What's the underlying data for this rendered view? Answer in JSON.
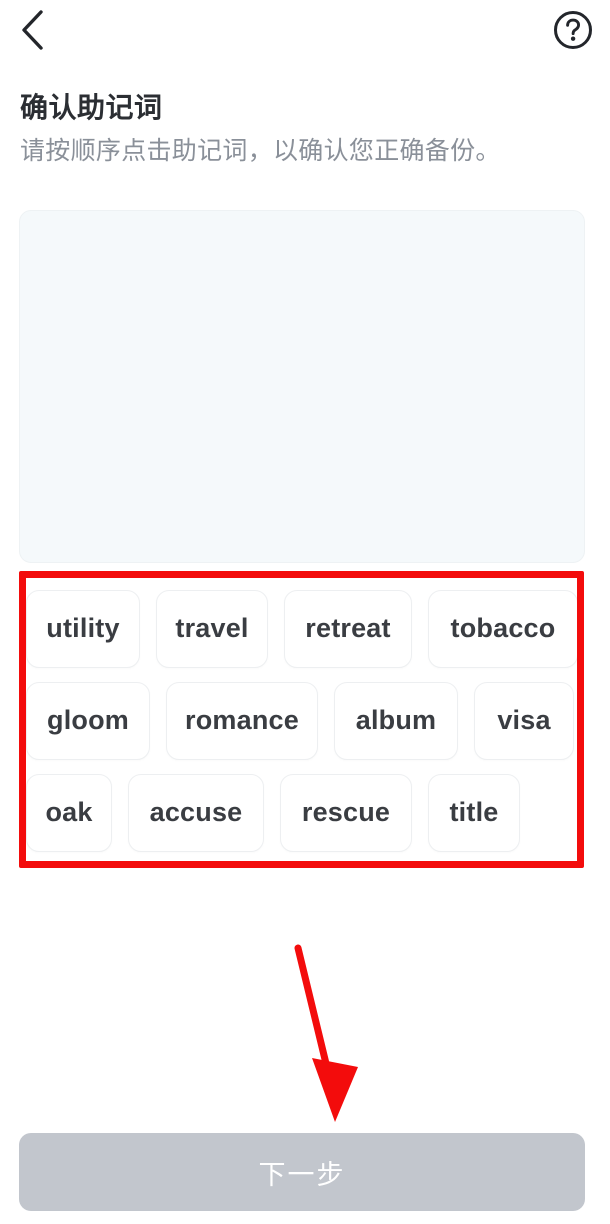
{
  "navbar": {
    "back_icon": "chevron-left-icon",
    "help_icon": "question-circle-icon"
  },
  "header": {
    "title": "确认助记词",
    "subtitle": "请按顺序点击助记词，以确认您正确备份。"
  },
  "selected_panel": {
    "selected_words": [],
    "placeholder": ""
  },
  "word_bank": {
    "rows": [
      {
        "words": [
          "utility",
          "travel",
          "retreat",
          "tobacco"
        ]
      },
      {
        "words": [
          "gloom",
          "romance",
          "album",
          "visa"
        ]
      },
      {
        "words": [
          "oak",
          "accuse",
          "rescue",
          "title"
        ]
      }
    ],
    "all_words": [
      "utility",
      "travel",
      "retreat",
      "tobacco",
      "gloom",
      "romance",
      "album",
      "visa",
      "oak",
      "accuse",
      "rescue",
      "title"
    ],
    "word_count": 12
  },
  "footer": {
    "next_label": "下一步",
    "next_enabled": false
  },
  "annotations": {
    "highlight_box_color": "#f30c0c",
    "arrow_color": "#f30c0c",
    "arrow_from": "word-bank",
    "arrow_to": "next-button"
  },
  "colors": {
    "page_background": "#ffffff",
    "panel_background": "#f5f9fb",
    "chip_background": "#ffffff",
    "chip_border": "#edeff1",
    "title_text": "#2b2e33",
    "subtitle_text": "#8a9099",
    "chip_text": "#3a3d42",
    "button_disabled": "#c2c6cd",
    "button_text": "#ffffff"
  }
}
